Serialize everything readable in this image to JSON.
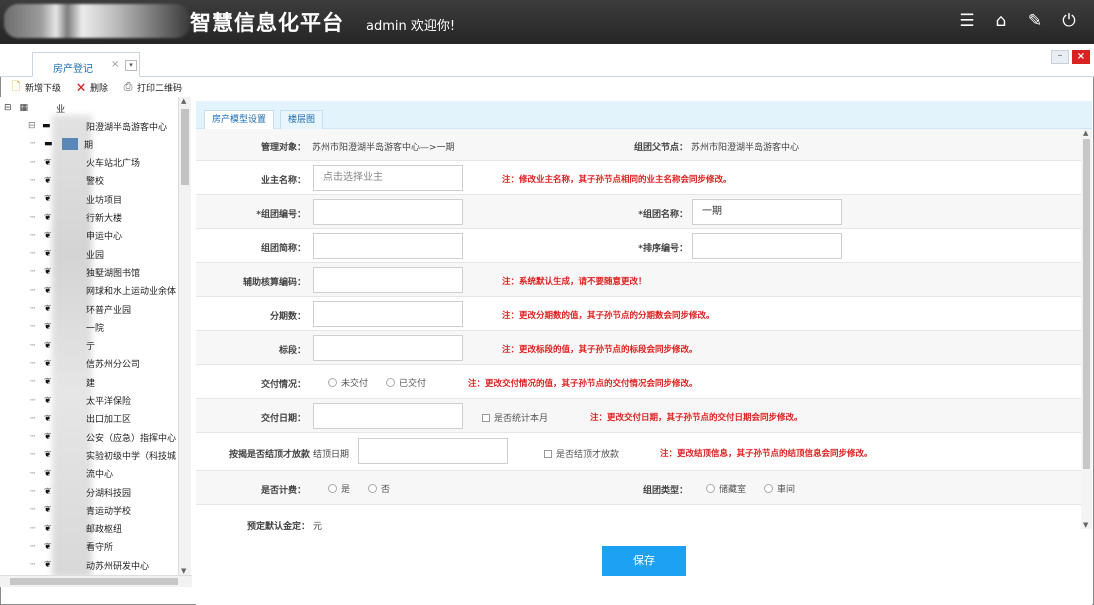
{
  "header": {
    "platform_title": "智慧信息化平台",
    "welcome": "admin 欢迎你!",
    "icons": [
      "menu-icon",
      "home-icon",
      "edit-icon",
      "power-icon"
    ]
  },
  "tabs": {
    "active_label": "房产登记",
    "close": "×",
    "dropdown": "▾"
  },
  "window_controls": {
    "minimize": "–",
    "close": "×"
  },
  "toolbar": {
    "add_child": "新增下级",
    "delete": "删除",
    "print_qr": "打印二维码"
  },
  "tree": {
    "root": "业",
    "items": [
      "阳澄湖半岛游客中心",
      "期",
      "火车站北广场",
      "警校",
      "业坊项目",
      "行新大楼",
      "申运中心",
      "业园",
      "独墅湖图书馆",
      "网球和水上运动业余体",
      "环普产业园",
      "一院",
      "亍",
      "信苏州分公司",
      "建",
      "太平洋保险",
      "出口加工区",
      "公安（应急）指挥中心",
      "实验初级中学（科技城",
      "流中心",
      "分湖科技园",
      "青运动学校",
      "邮政枢纽",
      "看守所",
      "动苏州研发中心"
    ]
  },
  "panel": {
    "tab_model": "房产模型设置",
    "tab_floor": "楼层图"
  },
  "form": {
    "manage_object_label": "管理对象：",
    "manage_object_value": "苏州市阳澄湖半岛游客中心—>一期",
    "parent_node_label": "组团父节点：",
    "parent_node_value": "苏州市阳澄湖半岛游客中心",
    "owner_label": "业主名称：",
    "owner_placeholder": "点击选择业主",
    "owner_note": "注：修改业主名称，其子孙节点相同的业主名称会同步修改。",
    "group_no_label": "*组团编号：",
    "group_name_label": "*组团名称：",
    "group_name_value": "一期",
    "group_short_label": "组团简称：",
    "sort_no_label": "*排序编号：",
    "aux_code_label": "辅助核算编码：",
    "aux_code_note": "注：系统默认生成，请不要随意更改！",
    "phases_label": "分期数：",
    "phases_note": "注：更改分期数的值，其子孙节点的分期数会同步修改。",
    "section_label": "标段：",
    "section_note": "注：更改标段的值，其子孙节点的标段会同步修改。",
    "delivery_label": "交付情况：",
    "delivery_opt1": "未交付",
    "delivery_opt2": "已交付",
    "delivery_note": "注：更改交付情况的值，其子孙节点的交付情况会同步修改。",
    "delivery_date_label": "交付日期：",
    "stat_month_label": "是否统计本月",
    "delivery_date_note": "注：更改交付日期，其子孙节点的交付日期会同步修改。",
    "settle_label": "按揭是否结顶才放款",
    "settle_date_label": "结顶日期",
    "settle_check_label": "是否结顶才放款",
    "settle_note": "注：更改结顶信息，其子孙节点的结顶信息会同步修改。",
    "billing_label": "是否计费：",
    "billing_yes": "是",
    "billing_no": "否",
    "group_type_label": "组团类型：",
    "group_type_opt1": "储藏室",
    "group_type_opt2": "車间",
    "default_amount_label": "预定默认金定：",
    "default_amount_value": "元"
  },
  "save_label": "保存"
}
